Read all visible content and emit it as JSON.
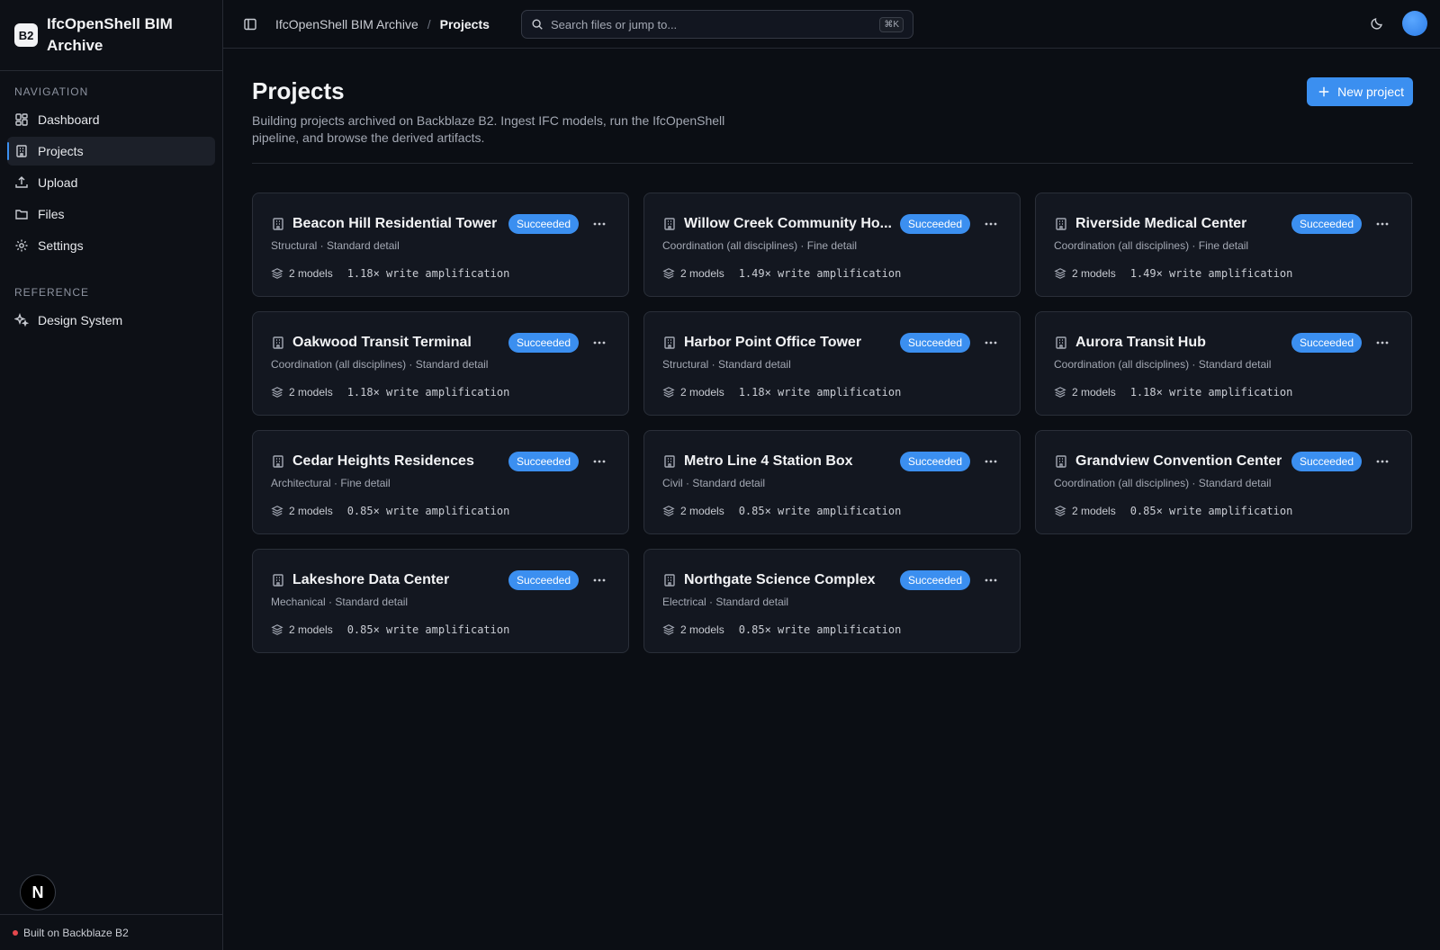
{
  "brand": {
    "logo": "B2",
    "name": "IfcOpenShell BIM Archive"
  },
  "sidebar": {
    "nav_heading": "Navigation",
    "items": [
      {
        "label": "Dashboard",
        "icon": "dashboard-icon"
      },
      {
        "label": "Projects",
        "icon": "building-icon",
        "active": true
      },
      {
        "label": "Upload",
        "icon": "upload-icon"
      },
      {
        "label": "Files",
        "icon": "folder-icon"
      },
      {
        "label": "Settings",
        "icon": "gear-icon"
      }
    ],
    "ref_heading": "Reference",
    "ref_items": [
      {
        "label": "Design System",
        "icon": "sparkles-icon"
      }
    ],
    "footer": "Built on Backblaze B2",
    "n_badge": "N"
  },
  "topbar": {
    "crumb_root": "IfcOpenShell BIM Archive",
    "crumb_sep": "/",
    "crumb_current": "Projects",
    "search_placeholder": "Search files or jump to...",
    "search_kbd": "⌘K"
  },
  "page": {
    "title": "Projects",
    "description": "Building projects archived on Backblaze B2. Ingest IFC models, run the IfcOpenShell pipeline, and browse the derived artifacts.",
    "new_button": "New project"
  },
  "projects": [
    {
      "name": "Beacon Hill Residential Tower",
      "sub": "Structural · Standard detail",
      "status": "Succeeded",
      "models": "2 models",
      "amp": "1.18× write amplification"
    },
    {
      "name": "Willow Creek Community Ho...",
      "sub": "Coordination (all disciplines) · Fine detail",
      "status": "Succeeded",
      "models": "2 models",
      "amp": "1.49× write amplification"
    },
    {
      "name": "Riverside Medical Center",
      "sub": "Coordination (all disciplines) · Fine detail",
      "status": "Succeeded",
      "models": "2 models",
      "amp": "1.49× write amplification"
    },
    {
      "name": "Oakwood Transit Terminal",
      "sub": "Coordination (all disciplines) · Standard detail",
      "status": "Succeeded",
      "models": "2 models",
      "amp": "1.18× write amplification"
    },
    {
      "name": "Harbor Point Office Tower",
      "sub": "Structural · Standard detail",
      "status": "Succeeded",
      "models": "2 models",
      "amp": "1.18× write amplification"
    },
    {
      "name": "Aurora Transit Hub",
      "sub": "Coordination (all disciplines) · Standard detail",
      "status": "Succeeded",
      "models": "2 models",
      "amp": "1.18× write amplification"
    },
    {
      "name": "Cedar Heights Residences",
      "sub": "Architectural · Fine detail",
      "status": "Succeeded",
      "models": "2 models",
      "amp": "0.85× write amplification"
    },
    {
      "name": "Metro Line 4 Station Box",
      "sub": "Civil · Standard detail",
      "status": "Succeeded",
      "models": "2 models",
      "amp": "0.85× write amplification"
    },
    {
      "name": "Grandview Convention Center",
      "sub": "Coordination (all disciplines) · Standard detail",
      "status": "Succeeded",
      "models": "2 models",
      "amp": "0.85× write amplification"
    },
    {
      "name": "Lakeshore Data Center",
      "sub": "Mechanical · Standard detail",
      "status": "Succeeded",
      "models": "2 models",
      "amp": "0.85× write amplification"
    },
    {
      "name": "Northgate Science Complex",
      "sub": "Electrical · Standard detail",
      "status": "Succeeded",
      "models": "2 models",
      "amp": "0.85× write amplification"
    }
  ],
  "colors": {
    "accent": "#3b8ff0",
    "background": "#0b0e14",
    "card": "#131720"
  }
}
